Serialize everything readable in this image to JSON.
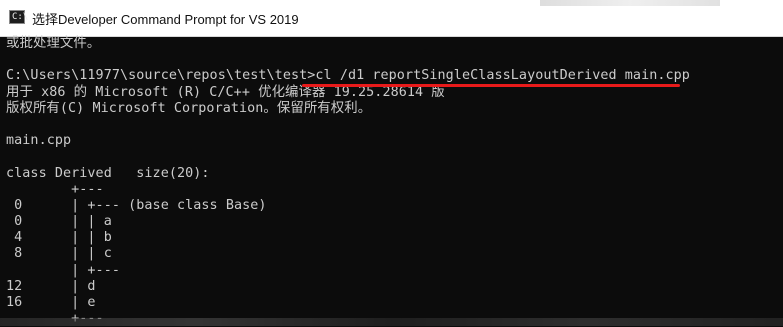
{
  "window": {
    "title": "选择Developer Command Prompt for VS 2019",
    "icon": "console-icon",
    "icon_glyph": "C:\\"
  },
  "console": {
    "lines": [
      "或批处理文件。",
      "",
      "C:\\Users\\11977\\source\\repos\\test\\test>cl /d1 reportSingleClassLayoutDerived main.cpp",
      "用于 x86 的 Microsoft (R) C/C++ 优化编译器 19.25.28614 版",
      "版权所有(C) Microsoft Corporation。保留所有权利。",
      "",
      "main.cpp",
      "",
      "class Derived   size(20):",
      "        +---",
      " 0      | +--- (base class Base)",
      " 0      | | a",
      " 4      | | b",
      " 8      | | c",
      "        | +---",
      "12      | d",
      "16      | e",
      "        +---"
    ]
  },
  "colors": {
    "background": "#0c0c0c",
    "text": "#cccccc",
    "underline": "#e81a1a"
  }
}
